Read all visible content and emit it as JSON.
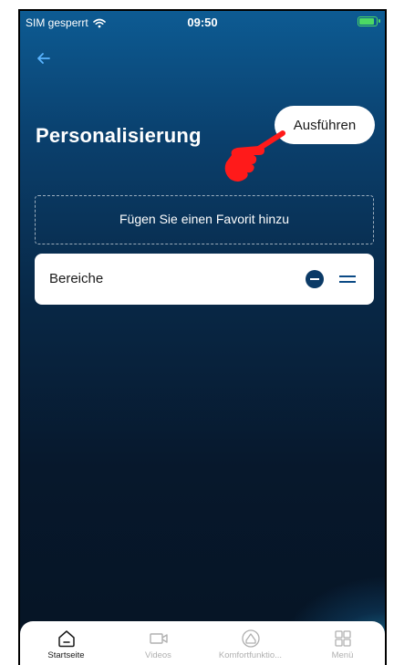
{
  "status_bar": {
    "carrier": "SIM gesperrt",
    "time": "09:50",
    "wifi_icon": "wifi-icon",
    "battery_icon": "battery-charging-icon",
    "battery_color": "#4cd964"
  },
  "header": {
    "back_icon": "back-arrow-icon",
    "title": "Personalisierung",
    "run_label": "Ausführen"
  },
  "annotation": {
    "icon": "pointing-hand-icon",
    "color": "#ff0000"
  },
  "favorites": {
    "placeholder": "Fügen Sie einen Favorit hinzu"
  },
  "sections": [
    {
      "label": "Bereiche",
      "remove_icon": "remove-circle-icon",
      "drag_icon": "drag-handle-icon"
    }
  ],
  "tab_bar": {
    "tabs": [
      {
        "label": "Startseite",
        "icon": "home-icon",
        "active": true
      },
      {
        "label": "Videos",
        "icon": "video-camera-icon",
        "active": false
      },
      {
        "label": "Komfortfunktio...",
        "icon": "comfort-icon",
        "active": false
      },
      {
        "label": "Menü",
        "icon": "grid-menu-icon",
        "active": false
      }
    ]
  },
  "colors": {
    "accent": "#0b3a66",
    "background_top": "#0d5b93",
    "background_bottom": "#061424"
  }
}
